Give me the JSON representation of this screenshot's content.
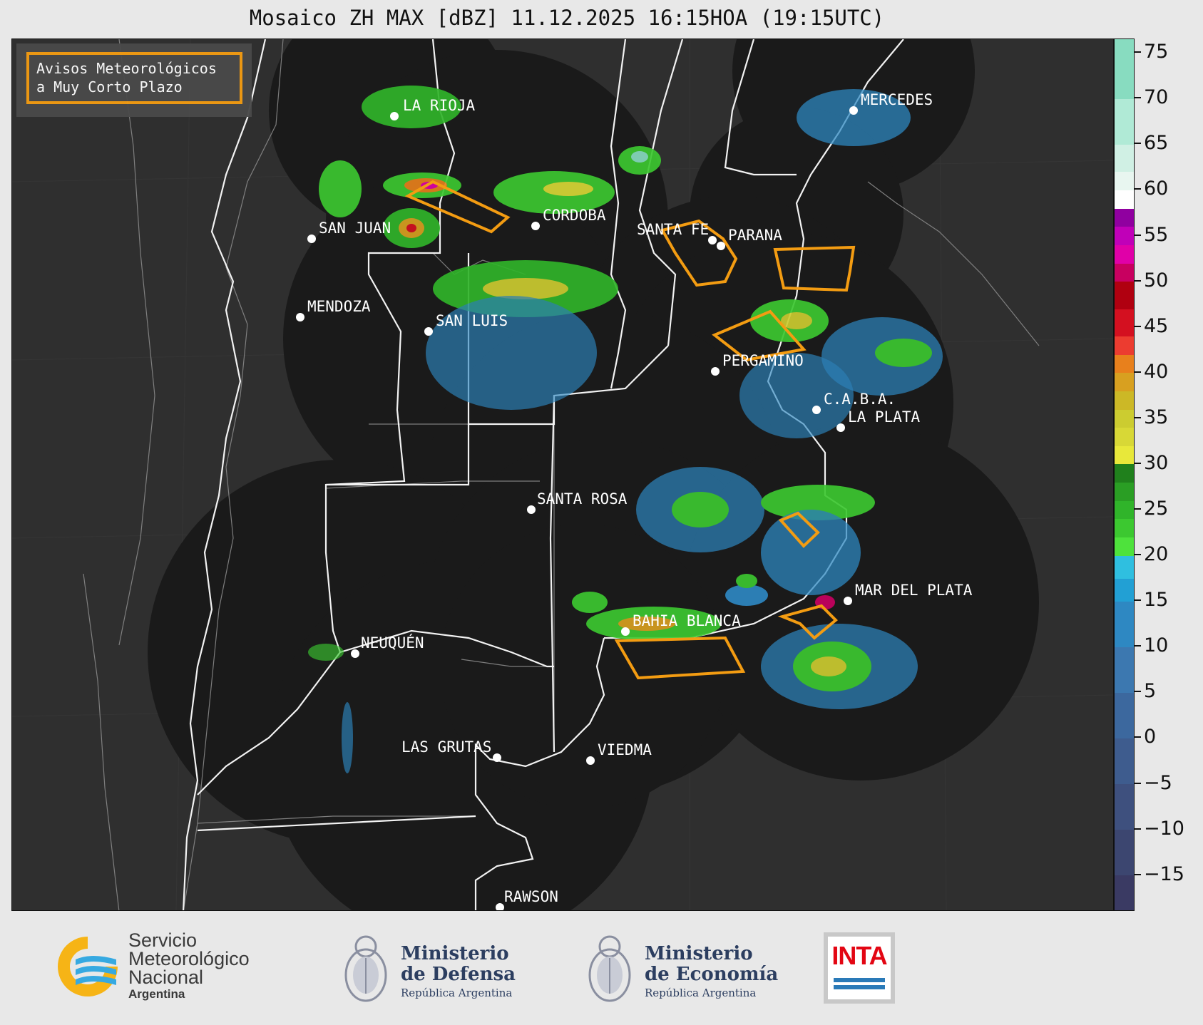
{
  "title": "Mosaico ZH MAX [dBZ] 11.12.2025 16:15HOA (19:15UTC)",
  "legend": {
    "line1": "Avisos Meteorológicos",
    "line2": "a Muy Corto Plazo",
    "border_color": "#f39c12"
  },
  "cities": [
    {
      "name": "LA RIOJA"
    },
    {
      "name": "SAN JUAN"
    },
    {
      "name": "CORDOBA"
    },
    {
      "name": "MENDOZA"
    },
    {
      "name": "SAN LUIS"
    },
    {
      "name": "SANTA FE"
    },
    {
      "name": "PARANA"
    },
    {
      "name": "MERCEDES"
    },
    {
      "name": "PERGAMINO"
    },
    {
      "name": "C.A.B.A."
    },
    {
      "name": "LA PLATA"
    },
    {
      "name": "SANTA ROSA"
    },
    {
      "name": "NEUQUÉN"
    },
    {
      "name": "BAHIA BLANCA"
    },
    {
      "name": "MAR DEL PLATA"
    },
    {
      "name": "LAS GRUTAS"
    },
    {
      "name": "VIEDMA"
    },
    {
      "name": "RAWSON"
    }
  ],
  "colorbar": {
    "unit": "dBZ",
    "min": -19,
    "max": 76.5,
    "ticks": [
      "75",
      "70",
      "65",
      "60",
      "55",
      "50",
      "45",
      "40",
      "35",
      "30",
      "25",
      "20",
      "15",
      "10",
      "5",
      "0",
      "−5",
      "−10",
      "−15"
    ],
    "tick_values": [
      75,
      70,
      65,
      60,
      55,
      50,
      45,
      40,
      35,
      30,
      25,
      20,
      15,
      10,
      5,
      0,
      -5,
      -10,
      -15
    ],
    "colors": [
      {
        "from": -19,
        "to": -15,
        "color": "#3a3a63"
      },
      {
        "from": -15,
        "to": -10,
        "color": "#3c4670"
      },
      {
        "from": -10,
        "to": -5,
        "color": "#3e507e"
      },
      {
        "from": -5,
        "to": 0,
        "color": "#3e5c8e"
      },
      {
        "from": 0,
        "to": 5,
        "color": "#3c689e"
      },
      {
        "from": 5,
        "to": 10,
        "color": "#3c78b0"
      },
      {
        "from": 10,
        "to": 15,
        "color": "#2e88c2"
      },
      {
        "from": 15,
        "to": 17.5,
        "color": "#22a0d4"
      },
      {
        "from": 17.5,
        "to": 20,
        "color": "#2fbfe0"
      },
      {
        "from": 20,
        "to": 22,
        "color": "#4ee23c"
      },
      {
        "from": 22,
        "to": 24,
        "color": "#3cc830"
      },
      {
        "from": 24,
        "to": 26,
        "color": "#30b42a"
      },
      {
        "from": 26,
        "to": 28,
        "color": "#2a9e24"
      },
      {
        "from": 28,
        "to": 30,
        "color": "#20801c"
      },
      {
        "from": 30,
        "to": 32,
        "color": "#e8e83a"
      },
      {
        "from": 32,
        "to": 34,
        "color": "#d8d836"
      },
      {
        "from": 34,
        "to": 36,
        "color": "#cccc30"
      },
      {
        "from": 36,
        "to": 38,
        "color": "#ccb826"
      },
      {
        "from": 38,
        "to": 40,
        "color": "#d8a020"
      },
      {
        "from": 40,
        "to": 42,
        "color": "#e8801c"
      },
      {
        "from": 42,
        "to": 44,
        "color": "#ec3c30"
      },
      {
        "from": 44,
        "to": 47,
        "color": "#d41020"
      },
      {
        "from": 47,
        "to": 50,
        "color": "#b00010"
      },
      {
        "from": 50,
        "to": 52,
        "color": "#c80060"
      },
      {
        "from": 52,
        "to": 54,
        "color": "#e000a8"
      },
      {
        "from": 54,
        "to": 56,
        "color": "#c000b8"
      },
      {
        "from": 56,
        "to": 58,
        "color": "#9000a0"
      },
      {
        "from": 58,
        "to": 60,
        "color": "#ffffff"
      },
      {
        "from": 60,
        "to": 62,
        "color": "#e8f6f0"
      },
      {
        "from": 62,
        "to": 65,
        "color": "#d0f0e4"
      },
      {
        "from": 65,
        "to": 70,
        "color": "#b0ead6"
      },
      {
        "from": 70,
        "to": 76.5,
        "color": "#88dcc0"
      }
    ]
  },
  "footer": {
    "smn_line1": "Servicio",
    "smn_line2": "Meteorológico",
    "smn_line3": "Nacional",
    "smn_line4": "Argentina",
    "defensa_line1": "Ministerio",
    "defensa_line2": "de Defensa",
    "defensa_line3": "República Argentina",
    "economia_line1": "Ministerio",
    "economia_line2": "de Economía",
    "economia_line3": "República Argentina",
    "inta": "INTA"
  }
}
